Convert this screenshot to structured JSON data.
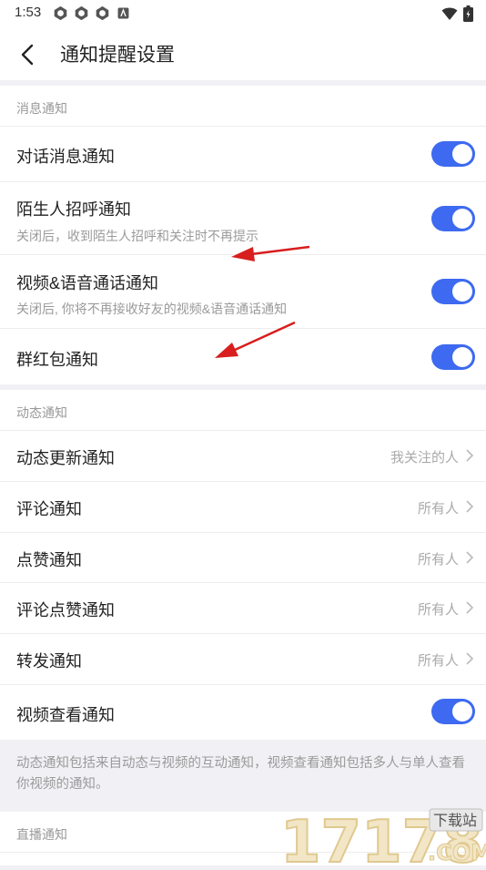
{
  "status_bar": {
    "time": "1:53"
  },
  "header": {
    "title": "通知提醒设置"
  },
  "message_section": {
    "header": "消息通知",
    "items": [
      {
        "title": "对话消息通知",
        "subtitle": "",
        "toggle_on": true
      },
      {
        "title": "陌生人招呼通知",
        "subtitle": "关闭后，收到陌生人招呼和关注时不再提示",
        "toggle_on": true
      },
      {
        "title": "视频&语音通话通知",
        "subtitle": "关闭后, 你将不再接收好友的视频&语音通话通知",
        "toggle_on": true
      },
      {
        "title": "群红包通知",
        "subtitle": "",
        "toggle_on": true
      }
    ]
  },
  "feed_section": {
    "header": "动态通知",
    "items": [
      {
        "title": "动态更新通知",
        "value": "我关注的人"
      },
      {
        "title": "评论通知",
        "value": "所有人"
      },
      {
        "title": "点赞通知",
        "value": "所有人"
      },
      {
        "title": "评论点赞通知",
        "value": "所有人"
      },
      {
        "title": "转发通知",
        "value": "所有人"
      }
    ],
    "video_view": {
      "title": "视频查看通知",
      "toggle_on": true
    },
    "footnote": "动态通知包括来自动态与视频的互动通知，视频查看通知包括多人与单人查看你视频的通知。"
  },
  "live_section": {
    "header": "直播通知"
  },
  "watermark": {
    "text": "17178",
    "badge": "下载站",
    "domain": ".COM"
  },
  "colors": {
    "accent": "#3d6af0",
    "annotation_arrow": "#d81e1e"
  }
}
